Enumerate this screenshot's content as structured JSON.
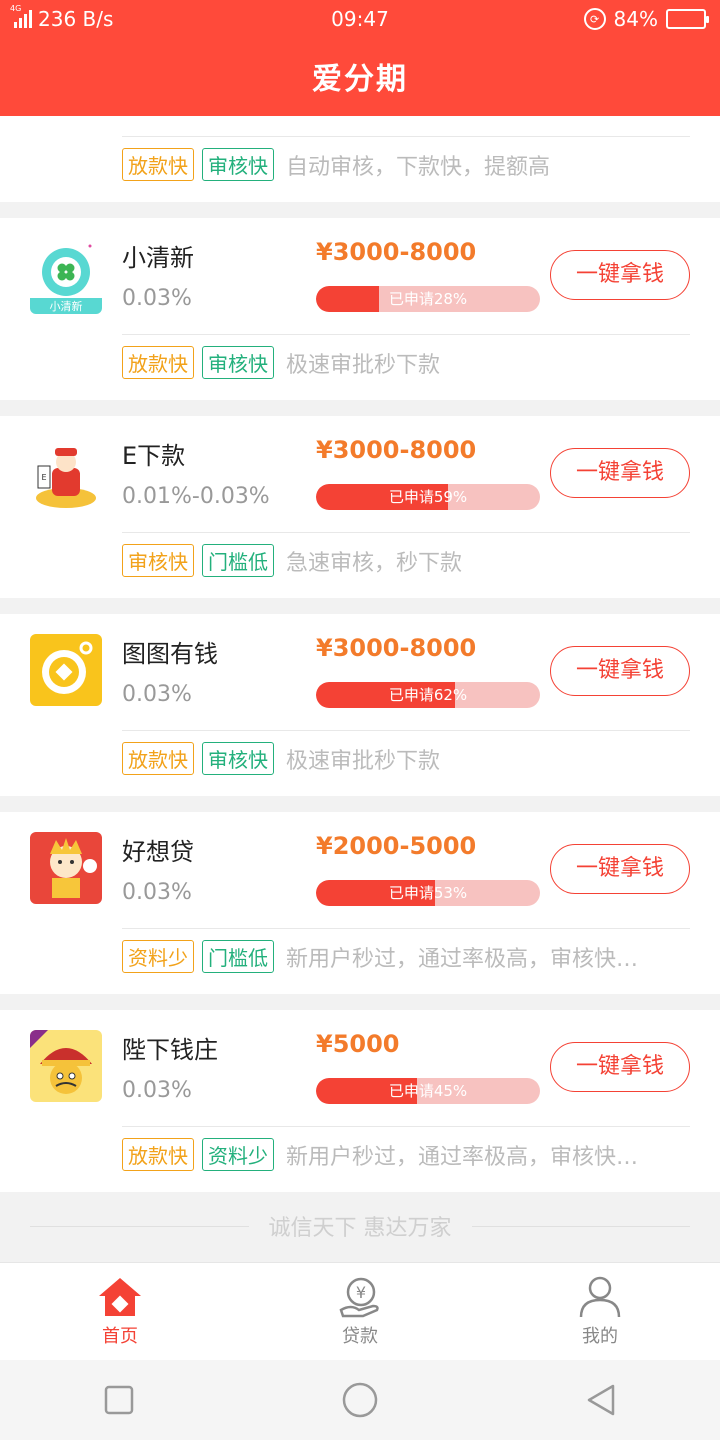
{
  "status_bar": {
    "net_tag": "4G",
    "speed": "236 B/s",
    "time": "09:47",
    "battery_pct": "84%",
    "battery_level": 0.84
  },
  "header": {
    "title": "爱分期"
  },
  "partial_card": {
    "tags": [
      {
        "label": "放款快",
        "color": "orange"
      },
      {
        "label": "审核快",
        "color": "green"
      }
    ],
    "desc": "自动审核，下款快，提额高"
  },
  "cards": [
    {
      "name": "小清新",
      "rate": "0.03%",
      "amount": "¥3000-8000",
      "applied_text": "已申请28%",
      "applied_pct": 28,
      "button": "一键拿钱",
      "tags": [
        {
          "label": "放款快",
          "color": "orange"
        },
        {
          "label": "审核快",
          "color": "green"
        }
      ],
      "desc": "极速审批秒下款",
      "logo": {
        "type": "xiaoqingxin",
        "caption": "小清新"
      }
    },
    {
      "name": "E下款",
      "rate": "0.01%-0.03%",
      "amount": "¥3000-8000",
      "applied_text": "已申请59%",
      "applied_pct": 59,
      "button": "一键拿钱",
      "tags": [
        {
          "label": "审核快",
          "color": "orange"
        },
        {
          "label": "门槛低",
          "color": "green"
        }
      ],
      "desc": "急速审核，秒下款",
      "logo": {
        "type": "caishen"
      }
    },
    {
      "name": "图图有钱",
      "rate": "0.03%",
      "amount": "¥3000-8000",
      "applied_text": "已申请62%",
      "applied_pct": 62,
      "button": "一键拿钱",
      "tags": [
        {
          "label": "放款快",
          "color": "orange"
        },
        {
          "label": "审核快",
          "color": "green"
        }
      ],
      "desc": "极速审批秒下款",
      "logo": {
        "type": "coin"
      }
    },
    {
      "name": "好想贷",
      "rate": "0.03%",
      "amount": "¥2000-5000",
      "applied_text": "已申请53%",
      "applied_pct": 53,
      "button": "一键拿钱",
      "tags": [
        {
          "label": "资料少",
          "color": "orange"
        },
        {
          "label": "门槛低",
          "color": "green"
        }
      ],
      "desc": "新用户秒过，通过率极高，审核快…",
      "logo": {
        "type": "haoxiangdai"
      }
    },
    {
      "name": "陛下钱庄",
      "rate": "0.03%",
      "amount": "¥5000",
      "applied_text": "已申请45%",
      "applied_pct": 45,
      "button": "一键拿钱",
      "tags": [
        {
          "label": "放款快",
          "color": "orange"
        },
        {
          "label": "资料少",
          "color": "green"
        }
      ],
      "desc": "新用户秒过，通过率极高，审核快…",
      "logo": {
        "type": "emperor"
      }
    }
  ],
  "footer_slogan": "诚信天下 惠达万家",
  "tabbar": [
    {
      "label": "首页",
      "icon": "home-icon",
      "active": true
    },
    {
      "label": "贷款",
      "icon": "loan-icon",
      "active": false
    },
    {
      "label": "我的",
      "icon": "profile-icon",
      "active": false
    }
  ],
  "colors": {
    "brand": "#ff4a3a",
    "accent_orange": "#f37b2b",
    "tag_orange": "#f2a21a",
    "tag_green": "#23b07c"
  }
}
